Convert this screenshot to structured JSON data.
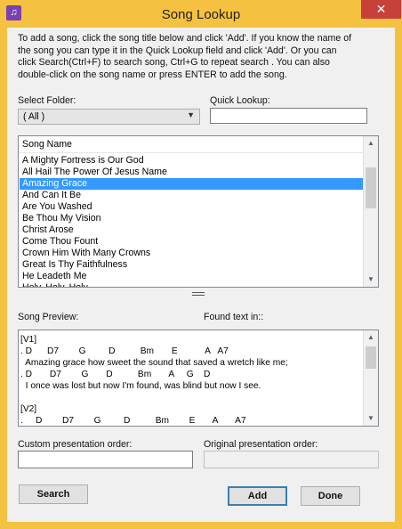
{
  "window": {
    "title": "Song Lookup",
    "close_glyph": "✕",
    "icon": "music-note-icon"
  },
  "instructions": "To add a song, click the song title below and click 'Add'. If you know the name of\nthe song you can type it in the Quick Lookup field and click 'Add'. Or you can\nclick Search(Ctrl+F) to search song, Ctrl+G to repeat search . You can also\ndouble-click on the song name or press ENTER to add the song.",
  "folder": {
    "label": "Select Folder:",
    "selected": "( All )"
  },
  "quick_lookup": {
    "label": "Quick Lookup:",
    "value": ""
  },
  "song_list": {
    "header": "Song Name",
    "items": [
      "A Mighty Fortress is Our God",
      "All Hail The Power Of Jesus Name",
      "Amazing Grace",
      "And Can It Be",
      "Are You Washed",
      "Be Thou My Vision",
      "Christ Arose",
      "Come Thou Fount",
      "Crown Him With Many Crowns",
      "Great Is Thy Faithfulness",
      "He Leadeth Me",
      "Holy, Holy, Holy"
    ],
    "selected_index": 2
  },
  "preview": {
    "label": "Song Preview:",
    "found_label": "Found text in::",
    "text": "[V1]\n. D      D7        G         D          Bm       E           A   A7\n  Amazing grace how sweet the sound that saved a wretch like me;\n. D       D7        G       D          Bm       A     G    D\n  I once was lost but now I'm found, was blind but now I see.\n\n[V2]\n.     D        D7        G         D          Bm        E       A       A7"
  },
  "custom_order": {
    "label": "Custom presentation order:",
    "value": ""
  },
  "original_order": {
    "label": "Original presentation order:",
    "value": ""
  },
  "buttons": {
    "search": "Search",
    "add": "Add",
    "done": "Done"
  },
  "colors": {
    "frame": "#f5c140",
    "selection": "#3399ff",
    "close": "#c7403a"
  }
}
